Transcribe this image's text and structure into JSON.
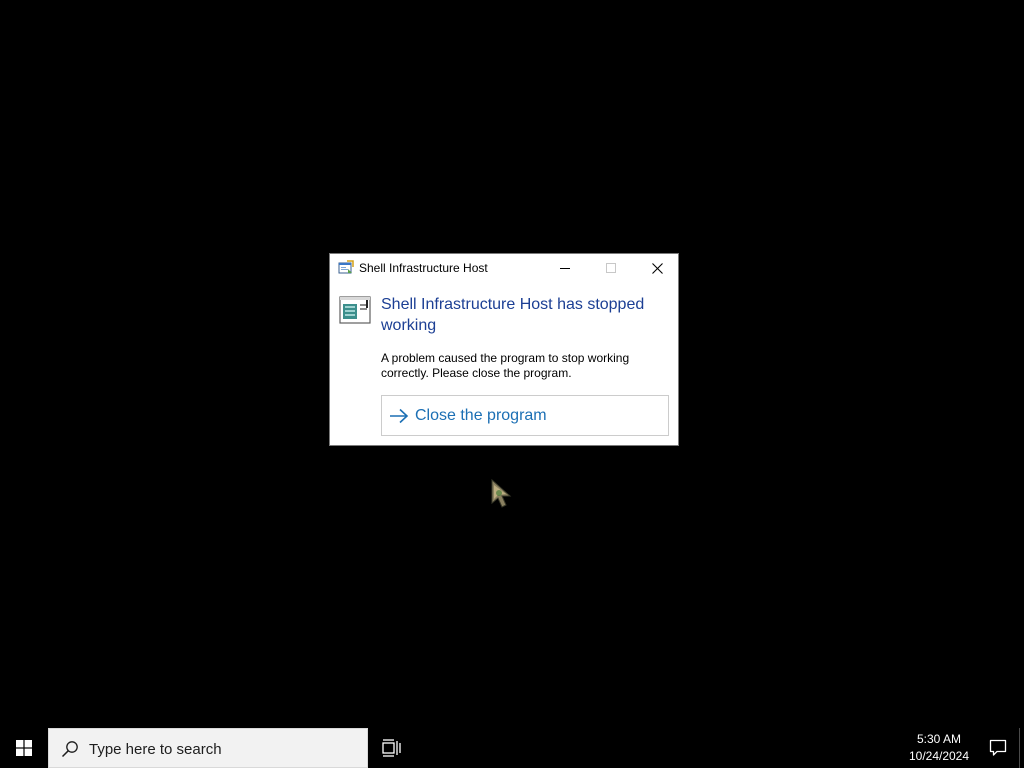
{
  "dialog": {
    "title": "Shell Infrastructure Host",
    "heading": "Shell Infrastructure Host has stopped working",
    "message": "A problem caused the program to stop working correctly. Please close the program.",
    "action_label": "Close the program",
    "icons": {
      "title": "app-window-icon",
      "app": "program-window-icon",
      "action": "arrow-right-icon",
      "minimize": "minimize-icon",
      "maximize": "maximize-icon",
      "close": "close-icon"
    }
  },
  "taskbar": {
    "search_placeholder": "Type here to search",
    "time": "5:30 AM",
    "date": "10/24/2024",
    "icons": {
      "start": "windows-logo-icon",
      "search": "search-icon",
      "task_view": "task-view-icon",
      "notifications": "action-center-icon"
    }
  },
  "colors": {
    "desktop": "#000000",
    "heading": "#1c3f94",
    "action_link": "#1b6fb4",
    "search_box": "#f2f2f2"
  }
}
